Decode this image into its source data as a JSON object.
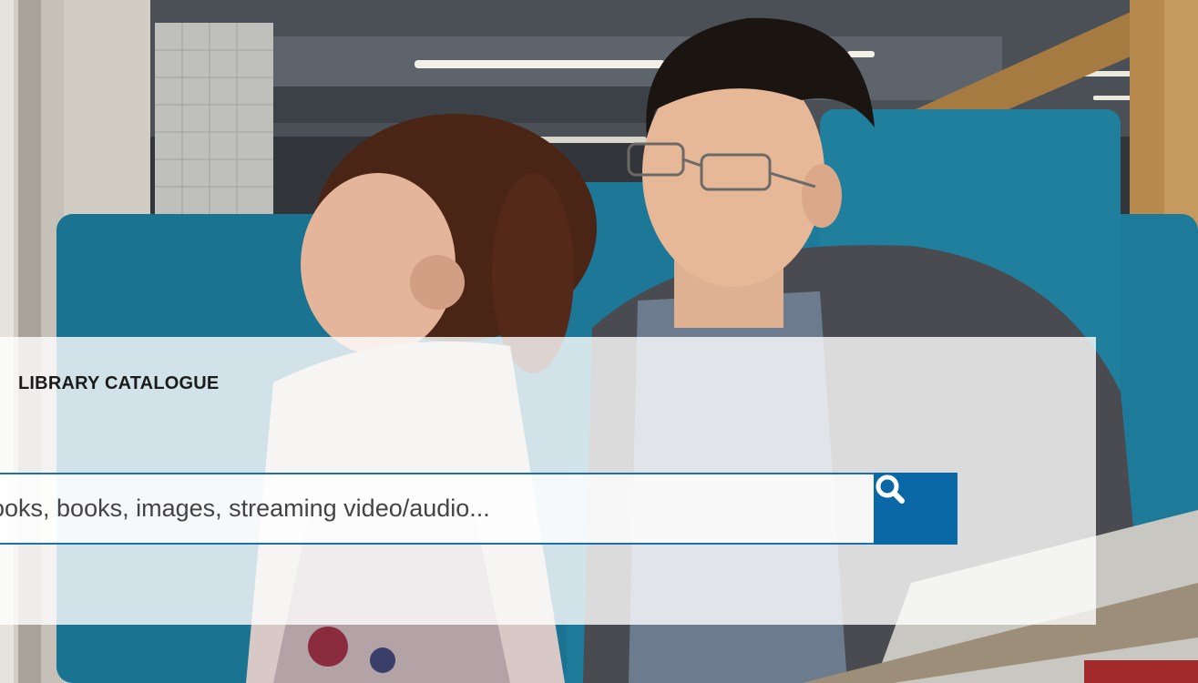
{
  "catalogue": {
    "heading": "LIBRARY CATALOGUE",
    "search_placeholder": "ooks, books, images, streaming video/audio...",
    "search_button_icon": "search-icon"
  },
  "colors": {
    "accent": "#0b68a6",
    "input_border": "#1f70b3",
    "heading_text": "#1b1b1b"
  }
}
